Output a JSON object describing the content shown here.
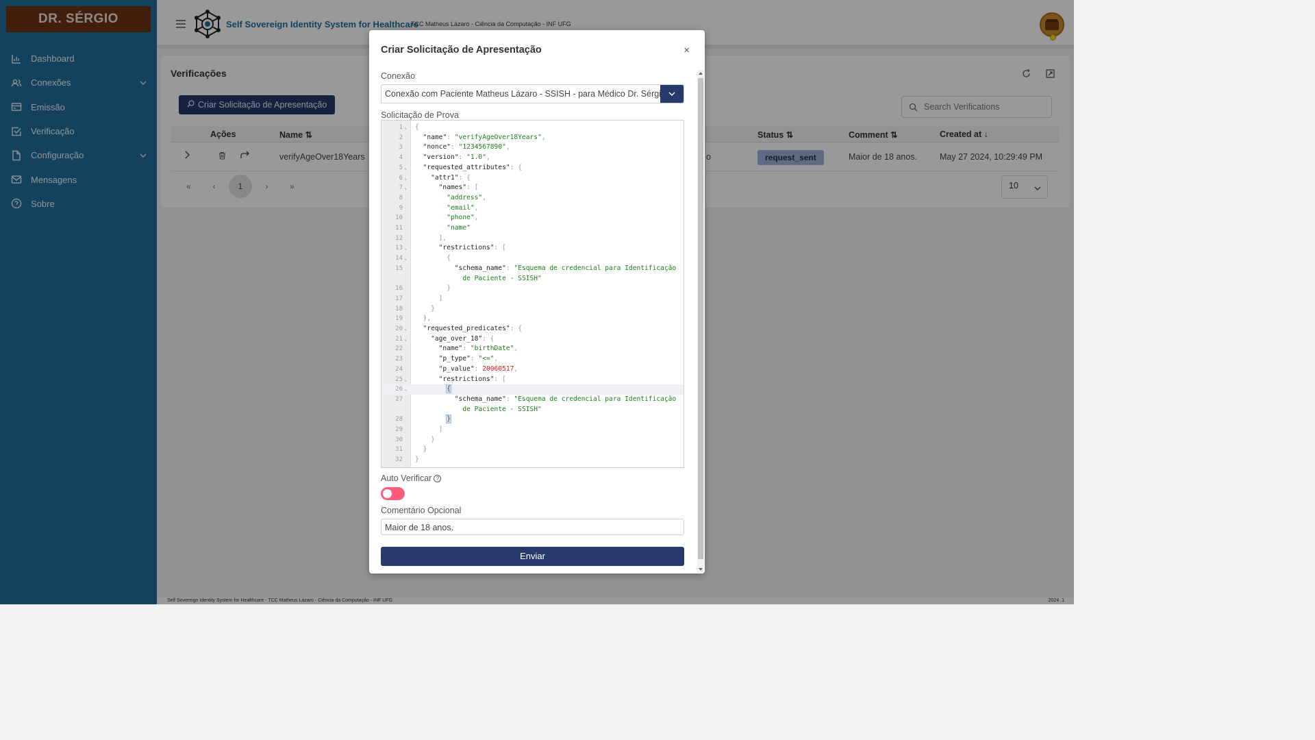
{
  "sidebar": {
    "brand": "DR. SÉRGIO",
    "items": [
      {
        "label": "Dashboard",
        "icon": "chart-icon"
      },
      {
        "label": "Conexões",
        "icon": "users-icon",
        "expandable": true
      },
      {
        "label": "Emissão",
        "icon": "card-icon"
      },
      {
        "label": "Verificação",
        "icon": "check-square-icon"
      },
      {
        "label": "Configuração",
        "icon": "file-icon",
        "expandable": true
      },
      {
        "label": "Mensagens",
        "icon": "mail-icon"
      },
      {
        "label": "Sobre",
        "icon": "help-circle-icon"
      }
    ]
  },
  "header": {
    "title": "Self Sovereign Identity System for Healthcare",
    "subtitle": "TCC Matheus Lázaro - Ciência da Computação - INF UFG"
  },
  "page": {
    "title": "Verificações",
    "create_button": "Criar Solicitação de Apresentação",
    "search_placeholder": "Search Verifications",
    "columns": {
      "actions": "Ações",
      "name": "Name",
      "status": "Status",
      "comment": "Comment",
      "created_at": "Created at"
    },
    "row": {
      "name": "verifyAgeOver18Years",
      "partial": "o",
      "status": "request_sent",
      "comment": "Maior de 18 anos.",
      "created_at": "May 27 2024, 10:29:49 PM"
    },
    "pagination": {
      "first": "«",
      "prev": "‹",
      "current": "1",
      "next": "›",
      "last": "»"
    },
    "rows_per_page": "10"
  },
  "modal": {
    "title": "Criar Solicitação de Apresentação",
    "close": "×",
    "connection_label": "Conexão",
    "connection_value": "Conexão com Paciente Matheus Lázaro - SSISH - para Médico Dr. Sérgio",
    "proof_label": "Solicitação de Prova",
    "auto_verify_label": "Auto Verificar",
    "auto_verify_help": "?",
    "comment_label": "Comentário Opcional",
    "comment_value": "Maior de 18 anos.",
    "submit": "Enviar"
  },
  "footer": {
    "left": "Self Sovereign Identity System for Healthcare - TCC Matheus Lázaro - Ciência da Computação - INF UFG",
    "right": "2024 .1"
  },
  "colors": {
    "sidebar": "#1e6f9c",
    "brand_bg": "#6e3414",
    "primary_button": "#263b6b",
    "status_pill": "#9db1d8",
    "toggle_off": "#ff5c7a",
    "json_string": "#1a7f1a",
    "json_number": "#d02020"
  }
}
